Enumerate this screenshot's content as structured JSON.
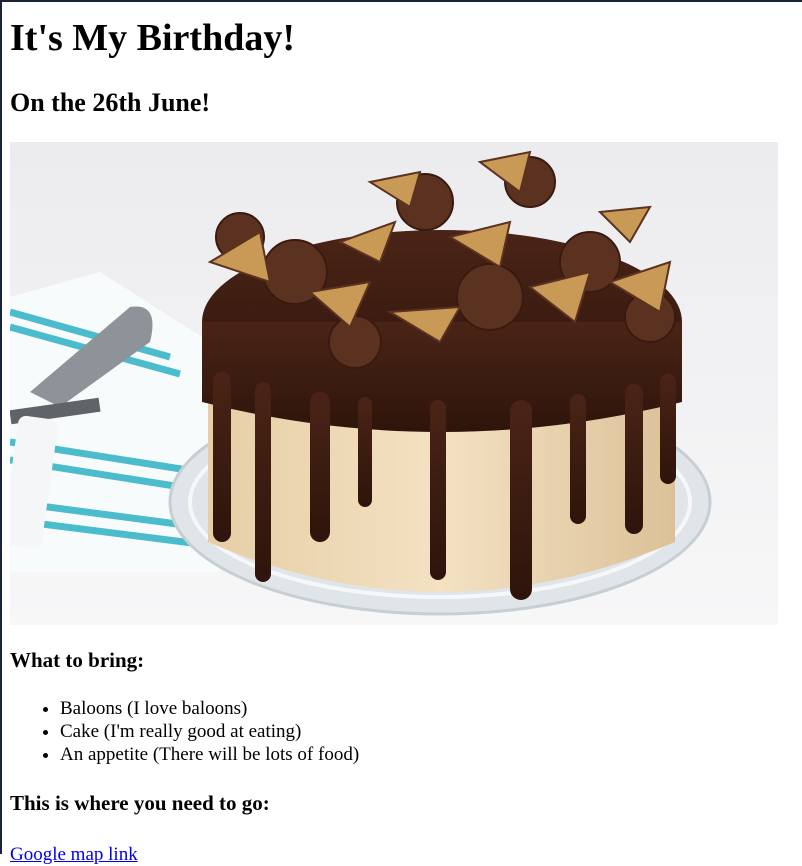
{
  "page": {
    "title": "It's My Birthday!",
    "date_heading": "On the 26th June!",
    "bring_heading": "What to bring:",
    "bring_items": [
      "Baloons (I love baloons)",
      "Cake (I'm really good at eating)",
      "An appetite (There will be lots of food)"
    ],
    "location_heading": "This is where you need to go:",
    "map_link": "Google map link"
  },
  "image": {
    "subject": "chocolate-drip-cake-with-peanut-butter-cups",
    "colors": {
      "ganache": "#3a1a10",
      "frosting": "#ecd8b4",
      "candy_fill": "#c99a56",
      "towel_stripe": "#4bbccc",
      "plate": "#dfe5e8",
      "background": "#f2f2f4"
    }
  }
}
